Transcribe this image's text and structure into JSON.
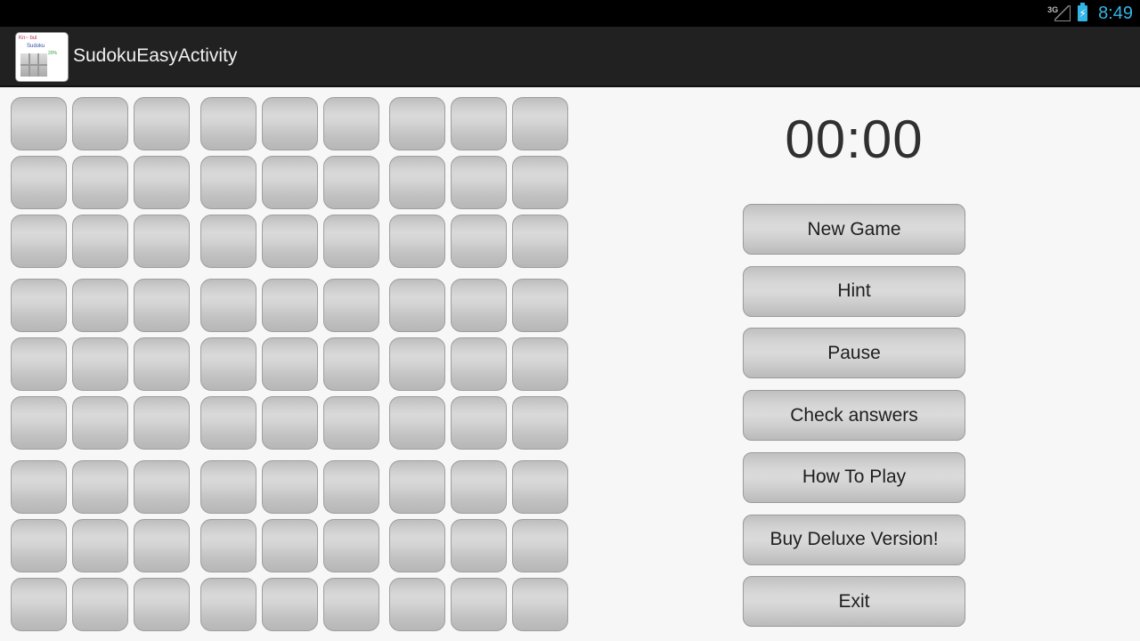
{
  "status_bar": {
    "network_label": "3G",
    "time": "8:49",
    "battery_state": "charging",
    "accent_color": "#33b5e5"
  },
  "action_bar": {
    "app_title": "SudokuEasyActivity",
    "icon_text_1": "Kn~ bul",
    "icon_text_2": "Sudoku",
    "icon_text_3": "20%"
  },
  "board": {
    "rows": 9,
    "cols": 9,
    "cells": [
      [
        "",
        "",
        "",
        "",
        "",
        "",
        "",
        "",
        ""
      ],
      [
        "",
        "",
        "",
        "",
        "",
        "",
        "",
        "",
        ""
      ],
      [
        "",
        "",
        "",
        "",
        "",
        "",
        "",
        "",
        ""
      ],
      [
        "",
        "",
        "",
        "",
        "",
        "",
        "",
        "",
        ""
      ],
      [
        "",
        "",
        "",
        "",
        "",
        "",
        "",
        "",
        ""
      ],
      [
        "",
        "",
        "",
        "",
        "",
        "",
        "",
        "",
        ""
      ],
      [
        "",
        "",
        "",
        "",
        "",
        "",
        "",
        "",
        ""
      ],
      [
        "",
        "",
        "",
        "",
        "",
        "",
        "",
        "",
        ""
      ],
      [
        "",
        "",
        "",
        "",
        "",
        "",
        "",
        "",
        ""
      ]
    ]
  },
  "timer": "00:00",
  "buttons": [
    {
      "id": "new-game",
      "label": "New Game"
    },
    {
      "id": "hint",
      "label": "Hint"
    },
    {
      "id": "pause",
      "label": "Pause"
    },
    {
      "id": "check-answers",
      "label": "Check answers"
    },
    {
      "id": "how-to-play",
      "label": "How To Play"
    },
    {
      "id": "buy-deluxe",
      "label": "Buy Deluxe Version!"
    },
    {
      "id": "exit",
      "label": "Exit"
    }
  ]
}
